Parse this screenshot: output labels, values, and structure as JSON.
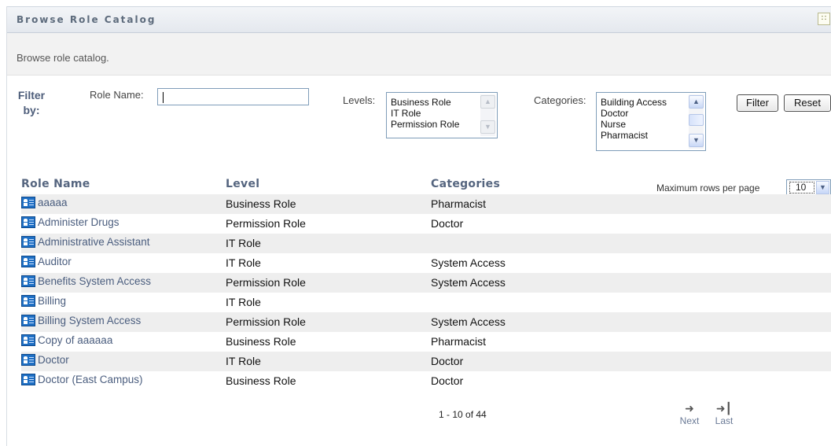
{
  "header": {
    "title": "Browse Role Catalog",
    "options_icon": "grid-icon"
  },
  "description": "Browse role catalog.",
  "filter": {
    "label_line1": "Filter",
    "label_line2": "by:",
    "role_name_label": "Role Name:",
    "role_name_value": "",
    "levels_label": "Levels:",
    "levels_options": [
      "Business Role",
      "IT Role",
      "Permission Role"
    ],
    "categories_label": "Categories:",
    "categories_options": [
      "Building Access",
      "Doctor",
      "Nurse",
      "Pharmacist"
    ],
    "filter_button": "Filter",
    "reset_button": "Reset"
  },
  "max_rows": {
    "label": "Maximum rows per page",
    "value": "10"
  },
  "table": {
    "columns": [
      "Role Name",
      "Level",
      "Categories"
    ],
    "rows": [
      {
        "name": "aaaaa",
        "level": "Business Role",
        "category": "Pharmacist"
      },
      {
        "name": "Administer Drugs",
        "level": "Permission Role",
        "category": "Doctor"
      },
      {
        "name": "Administrative Assistant",
        "level": "IT Role",
        "category": ""
      },
      {
        "name": "Auditor",
        "level": "IT Role",
        "category": "System Access"
      },
      {
        "name": "Benefits System Access",
        "level": "Permission Role",
        "category": "System Access"
      },
      {
        "name": "Billing",
        "level": "IT Role",
        "category": ""
      },
      {
        "name": "Billing System Access",
        "level": "Permission Role",
        "category": "System Access"
      },
      {
        "name": "Copy of aaaaaa",
        "level": "Business Role",
        "category": "Pharmacist"
      },
      {
        "name": "Doctor",
        "level": "IT Role",
        "category": "Doctor"
      },
      {
        "name": "Doctor (East Campus)",
        "level": "Business Role",
        "category": "Doctor"
      }
    ]
  },
  "pagination": {
    "info": "1 - 10 of 44",
    "next": "Next",
    "last": "Last"
  }
}
